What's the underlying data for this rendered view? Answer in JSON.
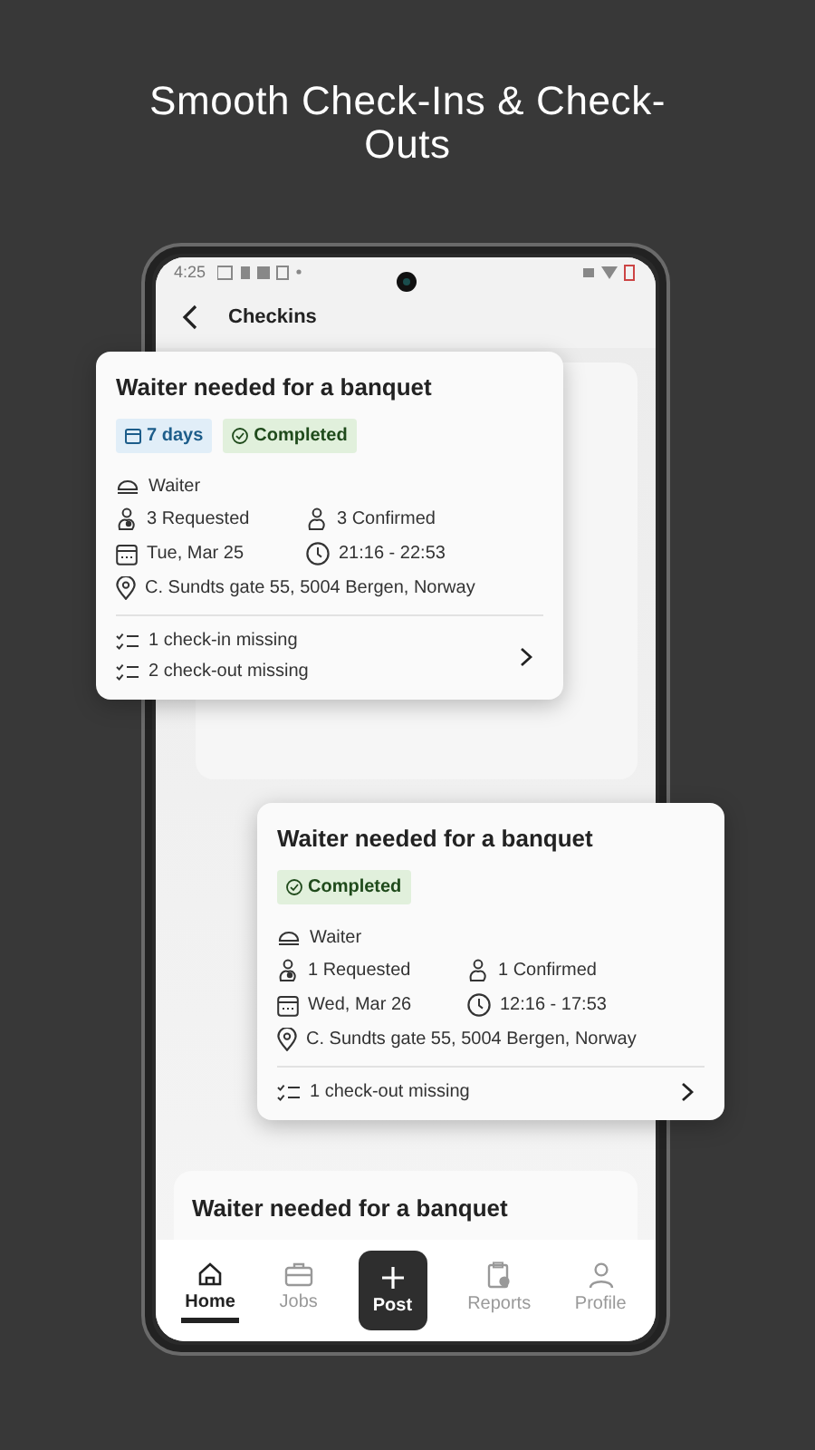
{
  "headline": "Smooth Check-Ins & Check-Outs",
  "status_bar": {
    "time": "4:25"
  },
  "header": {
    "title": "Checkins"
  },
  "cards": [
    {
      "title": "Waiter needed for a banquet",
      "badges": [
        {
          "kind": "duration",
          "label": "7 days"
        },
        {
          "kind": "status",
          "label": "Completed"
        }
      ],
      "role": "Waiter",
      "requested": "3 Requested",
      "confirmed": "3 Confirmed",
      "date": "Tue, Mar 25",
      "time": "21:16 - 22:53",
      "address": "C. Sundts gate 55, 5004 Bergen, Norway",
      "checks": [
        "1 check-in missing",
        "2 check-out missing"
      ]
    },
    {
      "title": "Waiter needed for a banquet",
      "badges": [
        {
          "kind": "status",
          "label": "Completed"
        }
      ],
      "role": "Waiter",
      "requested": "1 Requested",
      "confirmed": "1 Confirmed",
      "date": "Wed, Mar 26",
      "time": "12:16 - 17:53",
      "address": "C. Sundts gate 55, 5004 Bergen, Norway",
      "checks": [
        "1 check-out missing"
      ]
    }
  ],
  "background_card": {
    "title": "Waiter needed for a banquet"
  },
  "nav": [
    {
      "kind": "tab",
      "label": "Home",
      "selected": true
    },
    {
      "kind": "tab",
      "label": "Jobs",
      "selected": false
    },
    {
      "kind": "action",
      "label": "Post",
      "selected": false
    },
    {
      "kind": "tab",
      "label": "Reports",
      "selected": false
    },
    {
      "kind": "tab",
      "label": "Profile",
      "selected": false
    }
  ]
}
